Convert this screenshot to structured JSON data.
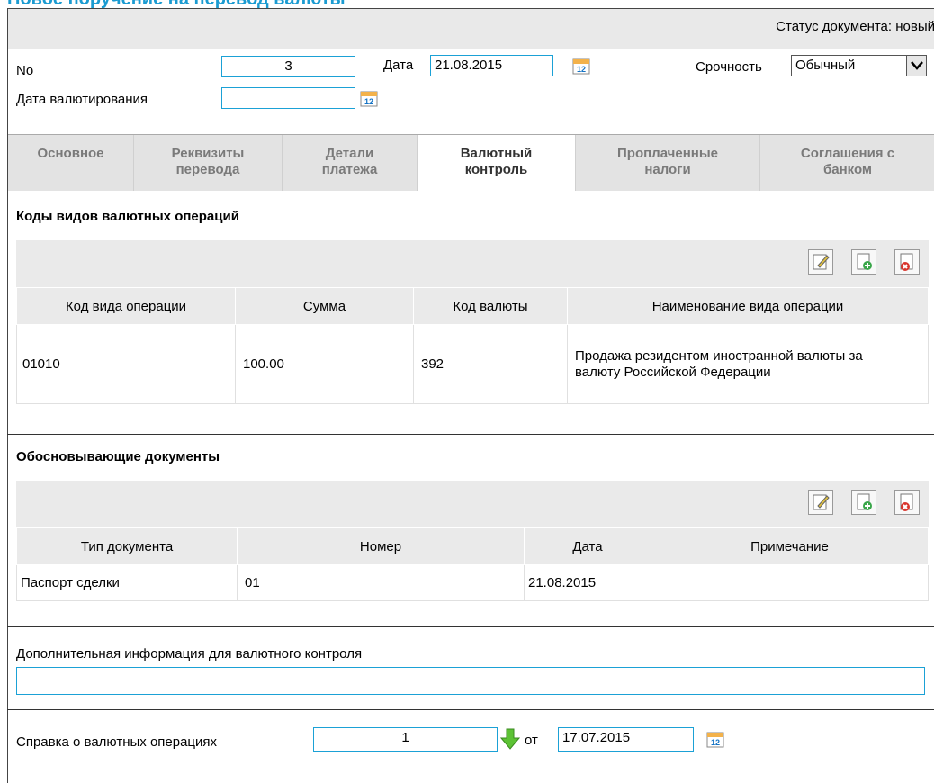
{
  "page_title": "Новое поручение на перевод валюты",
  "status": "Статус документа: новый",
  "header": {
    "no_label": "No",
    "no_value": "3",
    "date_label": "Дата",
    "date_value": "21.08.2015",
    "urgency_label": "Срочность",
    "urgency_value": "Обычный",
    "value_date_label": "Дата валютирования",
    "value_date_value": ""
  },
  "tabs": [
    {
      "label": "Основное"
    },
    {
      "label": "Реквизиты перевода"
    },
    {
      "label": "Детали платежа"
    },
    {
      "label": "Валютный контроль"
    },
    {
      "label": "Проплаченные налоги"
    },
    {
      "label": "Соглашения с банком"
    }
  ],
  "operations": {
    "title": "Коды видов валютных операций",
    "columns": [
      "Код вида операции",
      "Сумма",
      "Код валюты",
      "Наименование вида операции"
    ],
    "rows": [
      {
        "code": "01010",
        "sum": "100.00",
        "currency": "392",
        "name": "Продажа резидентом иностранной валюты за валюту Российской Федерации"
      }
    ]
  },
  "documents": {
    "title": "Обосновывающие документы",
    "columns": [
      "Тип документа",
      "Номер",
      "Дата",
      "Примечание"
    ],
    "rows": [
      {
        "type": "Паспорт сделки",
        "number": "01",
        "date": "21.08.2015",
        "note": ""
      }
    ]
  },
  "additional_info": {
    "label": "Дополнительная информация для валютного контроля",
    "value": ""
  },
  "certificate": {
    "label": "Справка о валютных операциях",
    "value": "1",
    "from_label": "от",
    "date": "17.07.2015"
  },
  "colors": {
    "accent": "#1b9bd1",
    "input_border": "#1ba1d6"
  },
  "icons": {
    "calendar": "calendar-icon",
    "edit": "edit-icon",
    "add": "add-icon",
    "delete": "delete-icon",
    "arrow": "down-arrow-icon"
  }
}
